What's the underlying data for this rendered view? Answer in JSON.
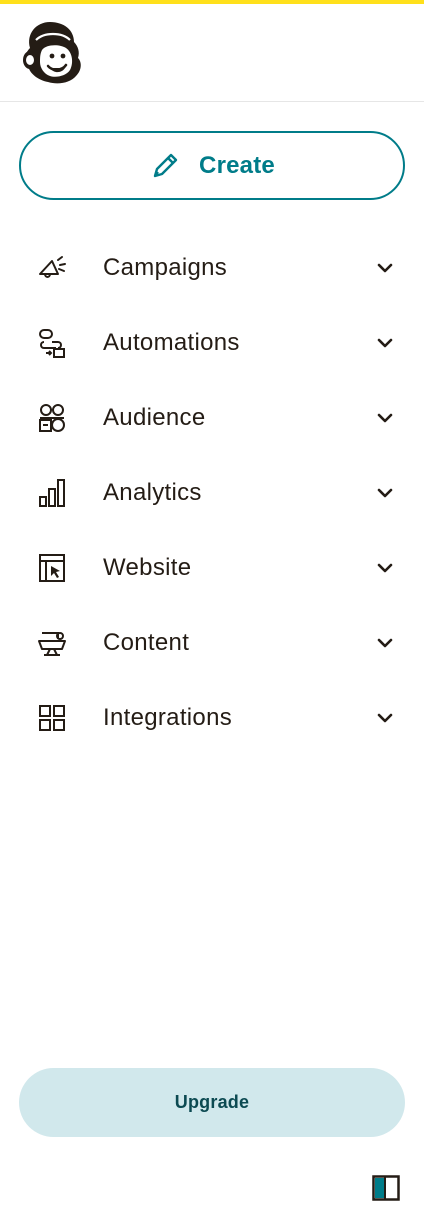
{
  "brand": {
    "accent": "#ffe01b",
    "primary": "#007c89",
    "logo_icon": "freddie-monkey-icon"
  },
  "create_button": {
    "label": "Create",
    "icon": "pencil-icon"
  },
  "nav": {
    "items": [
      {
        "label": "Campaigns",
        "icon": "megaphone-icon"
      },
      {
        "label": "Automations",
        "icon": "automation-flow-icon"
      },
      {
        "label": "Audience",
        "icon": "audience-icon"
      },
      {
        "label": "Analytics",
        "icon": "bar-chart-icon"
      },
      {
        "label": "Website",
        "icon": "website-cursor-icon"
      },
      {
        "label": "Content",
        "icon": "content-icon"
      },
      {
        "label": "Integrations",
        "icon": "grid-icon"
      }
    ]
  },
  "upgrade_button": {
    "label": "Upgrade",
    "background": "#d1e8ec"
  },
  "footer": {
    "toggle_icon": "sidebar-toggle-icon"
  }
}
